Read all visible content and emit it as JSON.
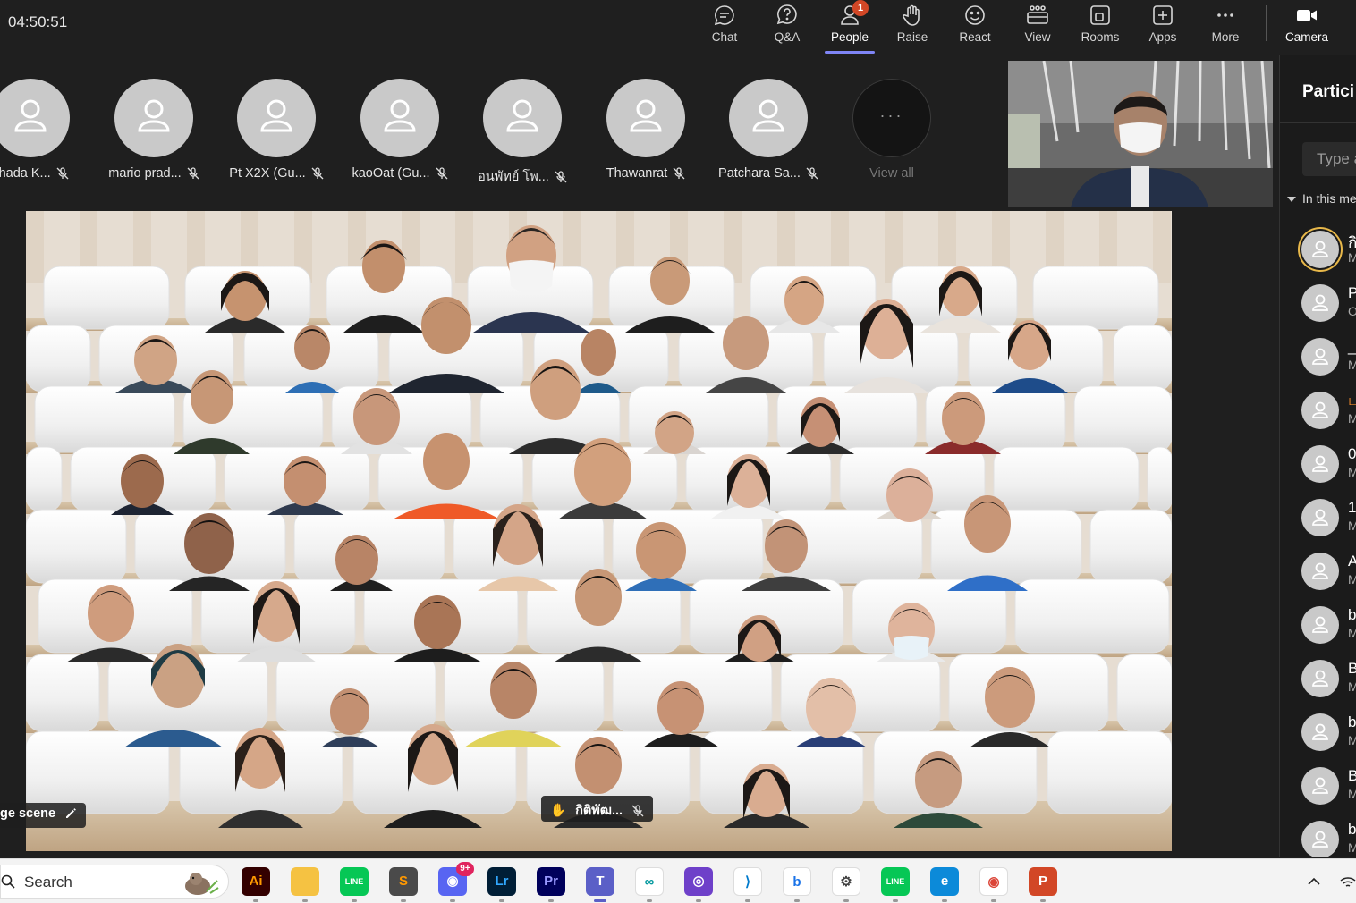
{
  "clock": "04:50:51",
  "toolbar": {
    "items": [
      {
        "label": "Chat",
        "icon": "chat-icon"
      },
      {
        "label": "Q&A",
        "icon": "qa-icon"
      },
      {
        "label": "People",
        "icon": "people-icon",
        "badge": "1",
        "active": true
      },
      {
        "label": "Raise",
        "icon": "raise-hand-icon"
      },
      {
        "label": "React",
        "icon": "react-icon"
      },
      {
        "label": "View",
        "icon": "view-icon"
      },
      {
        "label": "Rooms",
        "icon": "rooms-icon"
      },
      {
        "label": "Apps",
        "icon": "apps-icon"
      },
      {
        "label": "More",
        "icon": "more-icon"
      }
    ],
    "camera_label": "Camera"
  },
  "strip": {
    "participants": [
      {
        "name": "chada K..."
      },
      {
        "name": "mario prad..."
      },
      {
        "name": "Pt X2X (Gu..."
      },
      {
        "name": "kaoOat (Gu..."
      },
      {
        "name": "อนพัทย์ โพ..."
      },
      {
        "name": "Thawanrat"
      },
      {
        "name": "Patchara Sa..."
      }
    ],
    "view_all_label": "View all",
    "view_all_glyph": "···"
  },
  "panel": {
    "title": "Partici",
    "search_placeholder": "Type a",
    "section_label": "In this me",
    "list": [
      {
        "initial": "กิ",
        "status": "M"
      },
      {
        "initial": "P",
        "status": "O"
      },
      {
        "initial": "_a",
        "status": "M"
      },
      {
        "initial": "ப",
        "status": "M"
      },
      {
        "initial": "0",
        "status": "M"
      },
      {
        "initial": "1",
        "status": "M"
      },
      {
        "initial": "A",
        "status": "M"
      },
      {
        "initial": "b",
        "status": "M"
      },
      {
        "initial": "B",
        "status": "M"
      },
      {
        "initial": "b",
        "status": "M"
      },
      {
        "initial": "B",
        "status": "M"
      },
      {
        "initial": "b",
        "status": "M"
      }
    ]
  },
  "main_video": {
    "scene_label": "ge scene",
    "speaker_label": "กิติพัฒ..."
  },
  "taskbar": {
    "search_label": "Search",
    "apps": [
      {
        "name": "illustrator-icon",
        "text": "Ai",
        "bg": "#330000",
        "fg": "#ff9a00"
      },
      {
        "name": "file-explorer-icon",
        "text": "",
        "bg": "#f5c242",
        "fg": "#000"
      },
      {
        "name": "line-icon",
        "text": "LINE",
        "bg": "#06c755",
        "fg": "#fff"
      },
      {
        "name": "sublime-icon",
        "text": "S",
        "bg": "#4a4a4a",
        "fg": "#ff9800"
      },
      {
        "name": "discord-icon",
        "text": "◉",
        "bg": "#5865f2",
        "fg": "#fff",
        "badge": "9+"
      },
      {
        "name": "lightroom-icon",
        "text": "Lr",
        "bg": "#001e36",
        "fg": "#31a8ff"
      },
      {
        "name": "premiere-icon",
        "text": "Pr",
        "bg": "#00005b",
        "fg": "#9999ff"
      },
      {
        "name": "teams-icon",
        "text": "T",
        "bg": "#5b5fc7",
        "fg": "#fff"
      },
      {
        "name": "arduino-icon",
        "text": "∞",
        "bg": "#ffffff",
        "fg": "#00979d"
      },
      {
        "name": "github-icon",
        "text": "◎",
        "bg": "#6e40c9",
        "fg": "#fff"
      },
      {
        "name": "vscode-icon",
        "text": "⟩",
        "bg": "#ffffff",
        "fg": "#007acc"
      },
      {
        "name": "bing-icon",
        "text": "b",
        "bg": "#ffffff",
        "fg": "#1a73e8"
      },
      {
        "name": "settings-icon",
        "text": "⚙",
        "bg": "#ffffff",
        "fg": "#444"
      },
      {
        "name": "line-icon-2",
        "text": "LINE",
        "bg": "#06c755",
        "fg": "#fff"
      },
      {
        "name": "edge-icon",
        "text": "e",
        "bg": "#0c8ad9",
        "fg": "#fff"
      },
      {
        "name": "chrome-icon",
        "text": "◉",
        "bg": "#ffffff",
        "fg": "#db4437"
      },
      {
        "name": "powerpoint-icon",
        "text": "P",
        "bg": "#d24726",
        "fg": "#fff"
      }
    ]
  }
}
